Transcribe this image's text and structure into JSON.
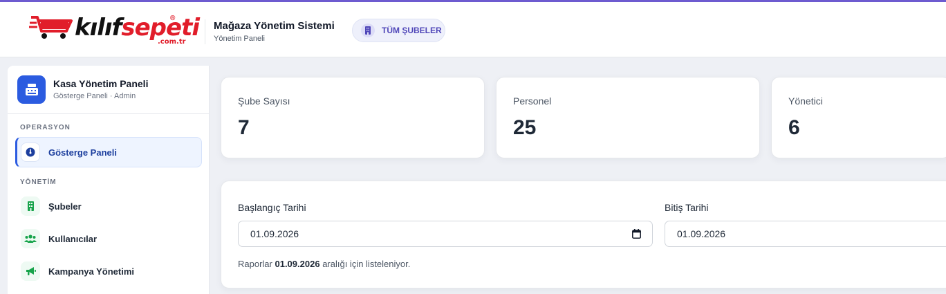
{
  "header": {
    "logo": {
      "word_a": "kılıf",
      "word_b": "sepeti",
      "reg": "®",
      "domain": ".com.tr"
    },
    "system_title": "Mağaza Yönetim Sistemi",
    "system_subtitle": "Yönetim Paneli",
    "branch_button": "TÜM ŞUBELER",
    "accent": "#6d5bd0"
  },
  "sidebar": {
    "title": "Kasa Yönetim Paneli",
    "subtitle": "Gösterge Paneli · Admin",
    "sections": [
      {
        "label": "OPERASYON"
      },
      {
        "label": "YÖNETİM"
      }
    ],
    "items": [
      {
        "label": "Gösterge Paneli",
        "icon": "gauge-icon",
        "active": true
      },
      {
        "label": "Şubeler",
        "icon": "building-icon"
      },
      {
        "label": "Kullanıcılar",
        "icon": "users-icon"
      },
      {
        "label": "Kampanya Yönetimi",
        "icon": "megaphone-icon"
      }
    ],
    "brand_color": "#2b5be0",
    "icon_green": "#16a34a"
  },
  "stats": [
    {
      "label": "Şube Sayısı",
      "value": "7"
    },
    {
      "label": "Personel",
      "value": "25"
    },
    {
      "label": "Yönetici",
      "value": "6"
    }
  ],
  "filters": {
    "start_label": "Başlangıç Tarihi",
    "start_value": "01.09.2026",
    "end_label": "Bitiş Tarihi",
    "end_value": "01.09.2026",
    "note_prefix": "Raporlar",
    "note_range": "01.09.2026",
    "note_suffix": "aralığı için listeleniyor."
  }
}
